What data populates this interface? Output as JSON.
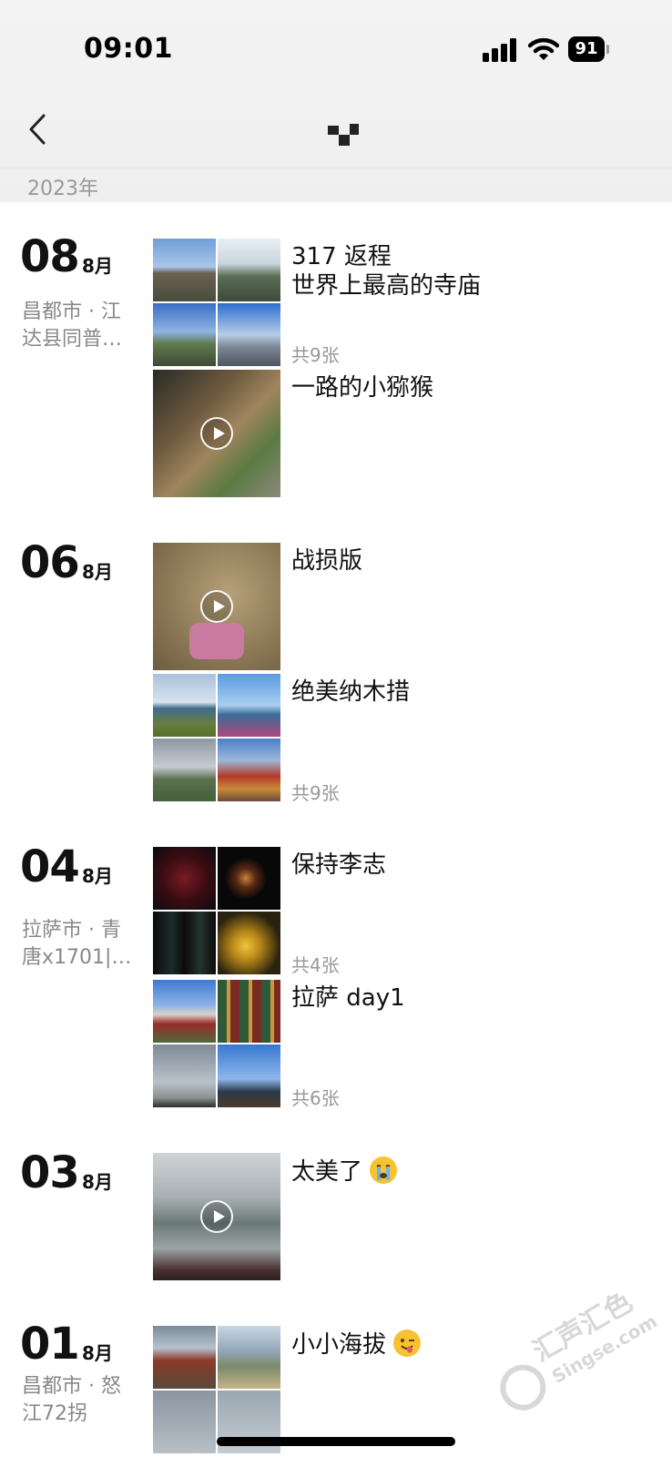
{
  "status_bar": {
    "time": "09:01",
    "battery": "91"
  },
  "header": {
    "year": "2023年"
  },
  "colors": {
    "accent": "#111111",
    "muted": "#999999",
    "location": "#888888"
  },
  "entries": [
    {
      "day": "08",
      "month": "8月",
      "location": "昌都市 · 江达县同普…",
      "posts": [
        {
          "type": "photos",
          "text": "317 返程\n世界上最高的寺庙",
          "count": "共9张"
        },
        {
          "type": "video",
          "text": "一路的小猕猴"
        }
      ]
    },
    {
      "day": "06",
      "month": "8月",
      "location": "",
      "posts": [
        {
          "type": "video",
          "text": "战损版"
        },
        {
          "type": "photos",
          "text": "绝美纳木措",
          "count": "共9张"
        }
      ]
    },
    {
      "day": "04",
      "month": "8月",
      "location": "拉萨市 · 青唐x1701|…",
      "posts": [
        {
          "type": "photos",
          "text": "保持李志",
          "count": "共4张"
        },
        {
          "type": "photos",
          "text": "拉萨 day1",
          "count": "共6张"
        }
      ]
    },
    {
      "day": "03",
      "month": "8月",
      "location": "",
      "posts": [
        {
          "type": "video",
          "text": "太美了",
          "emoji": "crying-face-emoji"
        }
      ]
    },
    {
      "day": "01",
      "month": "8月",
      "location": "昌都市 · 怒江72拐",
      "posts": [
        {
          "type": "photos",
          "text": "小小海拔",
          "emoji": "winking-tongue-emoji"
        }
      ]
    }
  ],
  "watermark": "汇声汇色 Singse.com"
}
